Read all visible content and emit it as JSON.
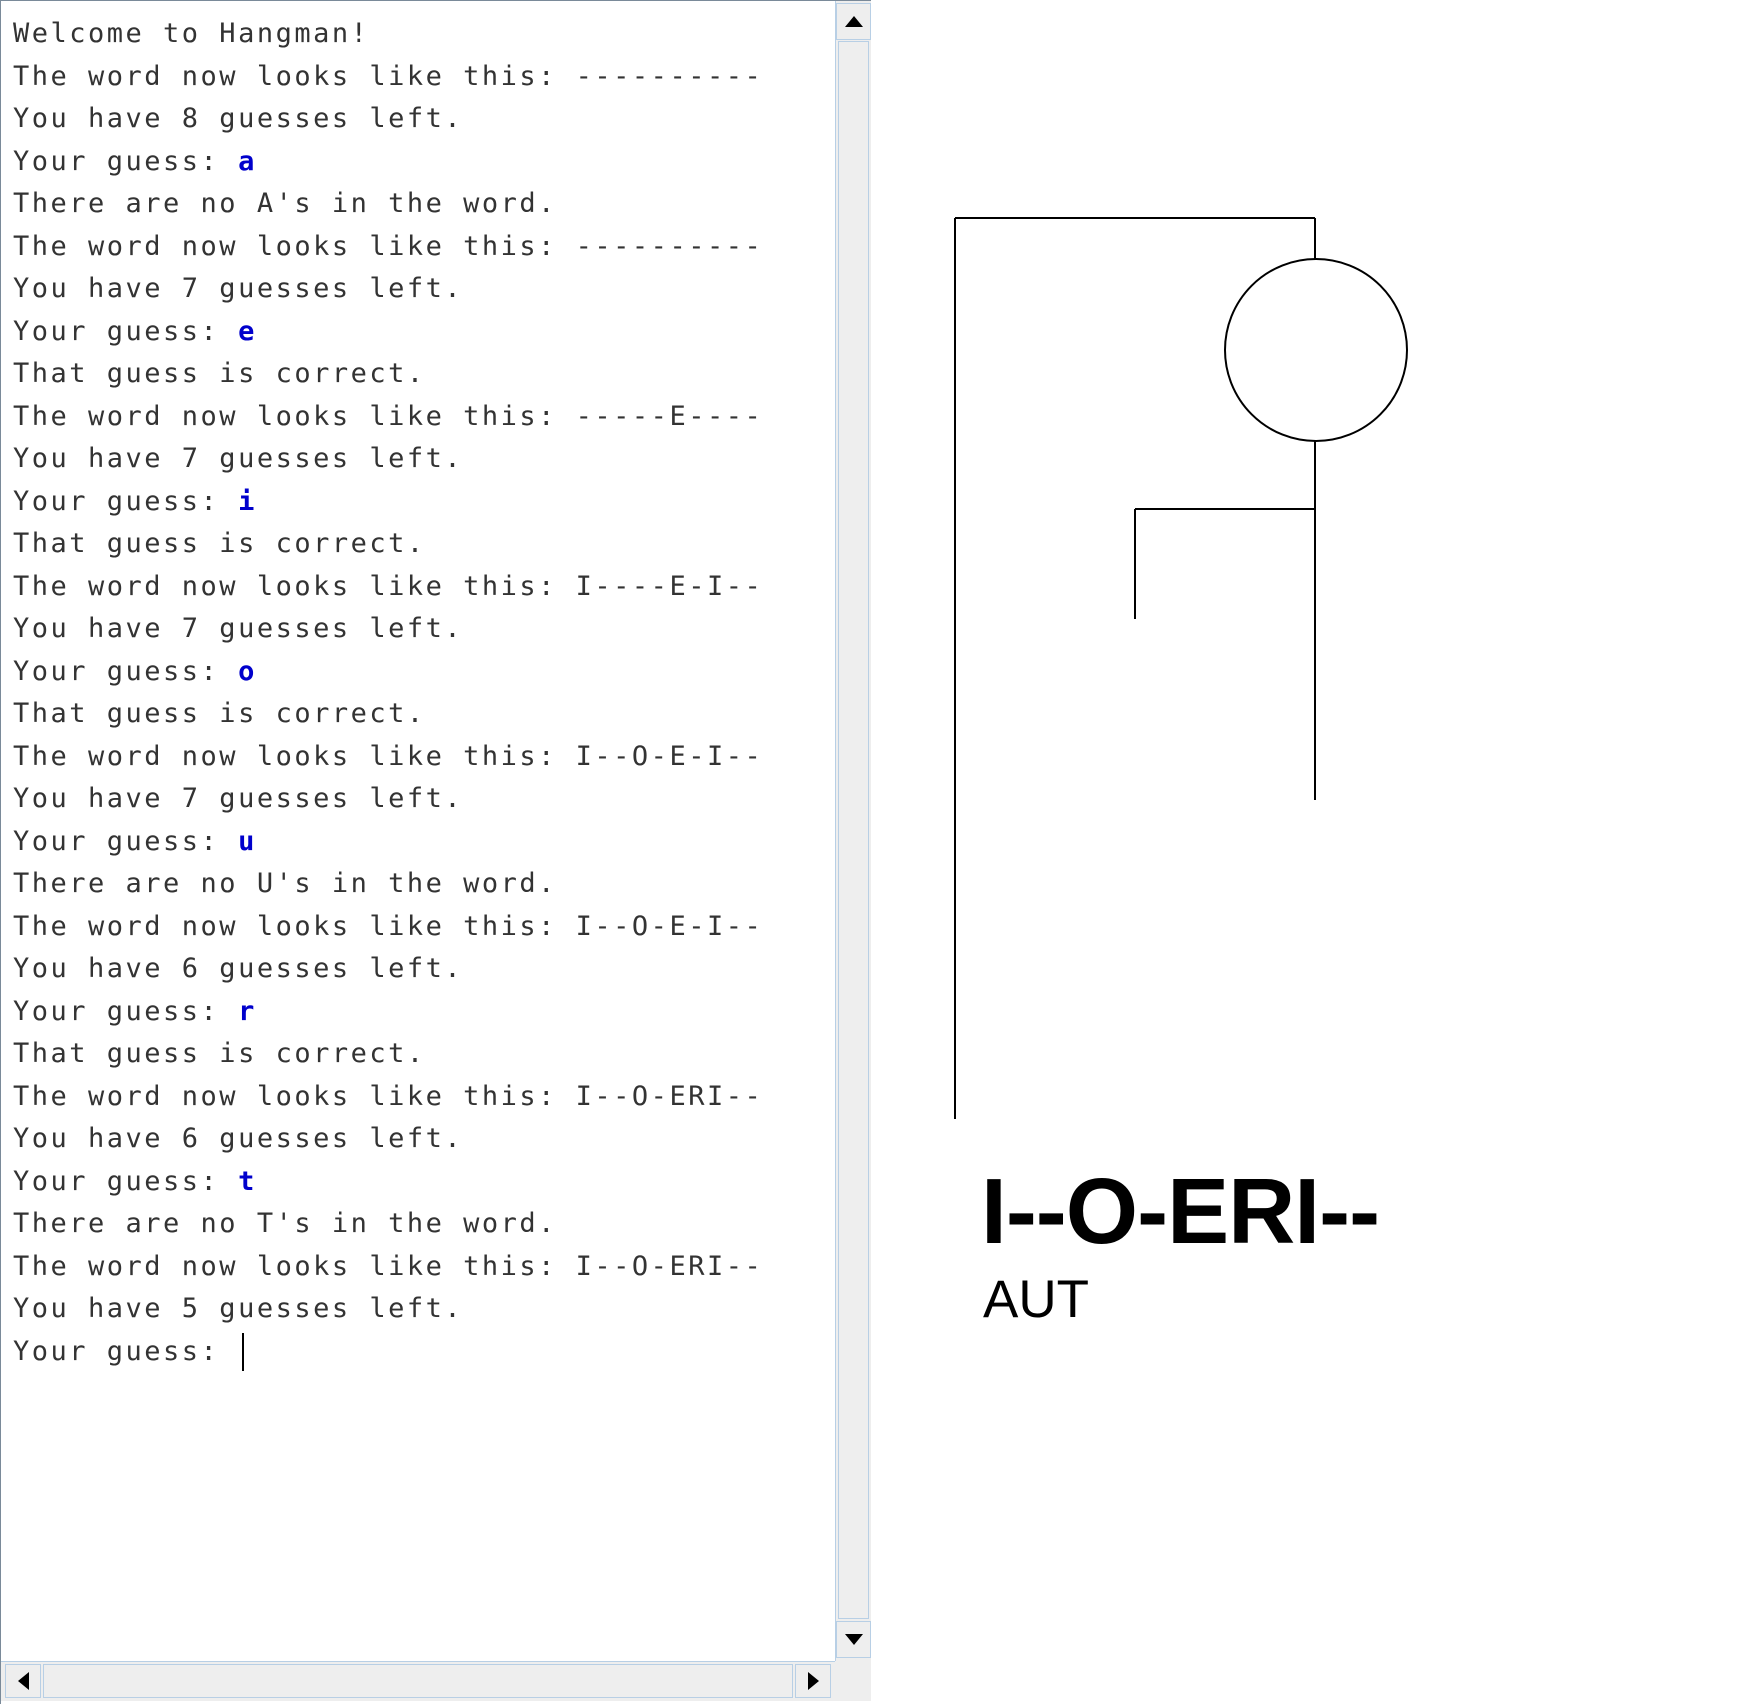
{
  "console": {
    "lines": [
      {
        "prompt": "Welcome to Hangman!",
        "input": ""
      },
      {
        "prompt": "The word now looks like this: ----------",
        "input": ""
      },
      {
        "prompt": "You have 8 guesses left.",
        "input": ""
      },
      {
        "prompt": "Your guess: ",
        "input": "a"
      },
      {
        "prompt": "There are no A's in the word.",
        "input": ""
      },
      {
        "prompt": "The word now looks like this: ----------",
        "input": ""
      },
      {
        "prompt": "You have 7 guesses left.",
        "input": ""
      },
      {
        "prompt": "Your guess: ",
        "input": "e"
      },
      {
        "prompt": "That guess is correct.",
        "input": ""
      },
      {
        "prompt": "The word now looks like this: -----E----",
        "input": ""
      },
      {
        "prompt": "You have 7 guesses left.",
        "input": ""
      },
      {
        "prompt": "Your guess: ",
        "input": "i"
      },
      {
        "prompt": "That guess is correct.",
        "input": ""
      },
      {
        "prompt": "The word now looks like this: I----E-I--",
        "input": ""
      },
      {
        "prompt": "You have 7 guesses left.",
        "input": ""
      },
      {
        "prompt": "Your guess: ",
        "input": "o"
      },
      {
        "prompt": "That guess is correct.",
        "input": ""
      },
      {
        "prompt": "The word now looks like this: I--O-E-I--",
        "input": ""
      },
      {
        "prompt": "You have 7 guesses left.",
        "input": ""
      },
      {
        "prompt": "Your guess: ",
        "input": "u"
      },
      {
        "prompt": "There are no U's in the word.",
        "input": ""
      },
      {
        "prompt": "The word now looks like this: I--O-E-I--",
        "input": ""
      },
      {
        "prompt": "You have 6 guesses left.",
        "input": ""
      },
      {
        "prompt": "Your guess: ",
        "input": "r"
      },
      {
        "prompt": "That guess is correct.",
        "input": ""
      },
      {
        "prompt": "The word now looks like this: I--O-ERI--",
        "input": ""
      },
      {
        "prompt": "You have 6 guesses left.",
        "input": ""
      },
      {
        "prompt": "Your guess: ",
        "input": "t"
      },
      {
        "prompt": "There are no T's in the word.",
        "input": ""
      },
      {
        "prompt": "The word now looks like this: I--O-ERI--",
        "input": ""
      },
      {
        "prompt": "You have 5 guesses left.",
        "input": ""
      }
    ],
    "active_prompt": "Your guess: ",
    "active_input": "",
    "colors": {
      "output": "#333333",
      "input": "#0000cc"
    }
  },
  "hangman": {
    "drawn_parts": [
      "scaffold",
      "rope",
      "head",
      "body",
      "left-arm"
    ],
    "current_word": "I--O-ERI--",
    "incorrect_letters": "AUT"
  }
}
